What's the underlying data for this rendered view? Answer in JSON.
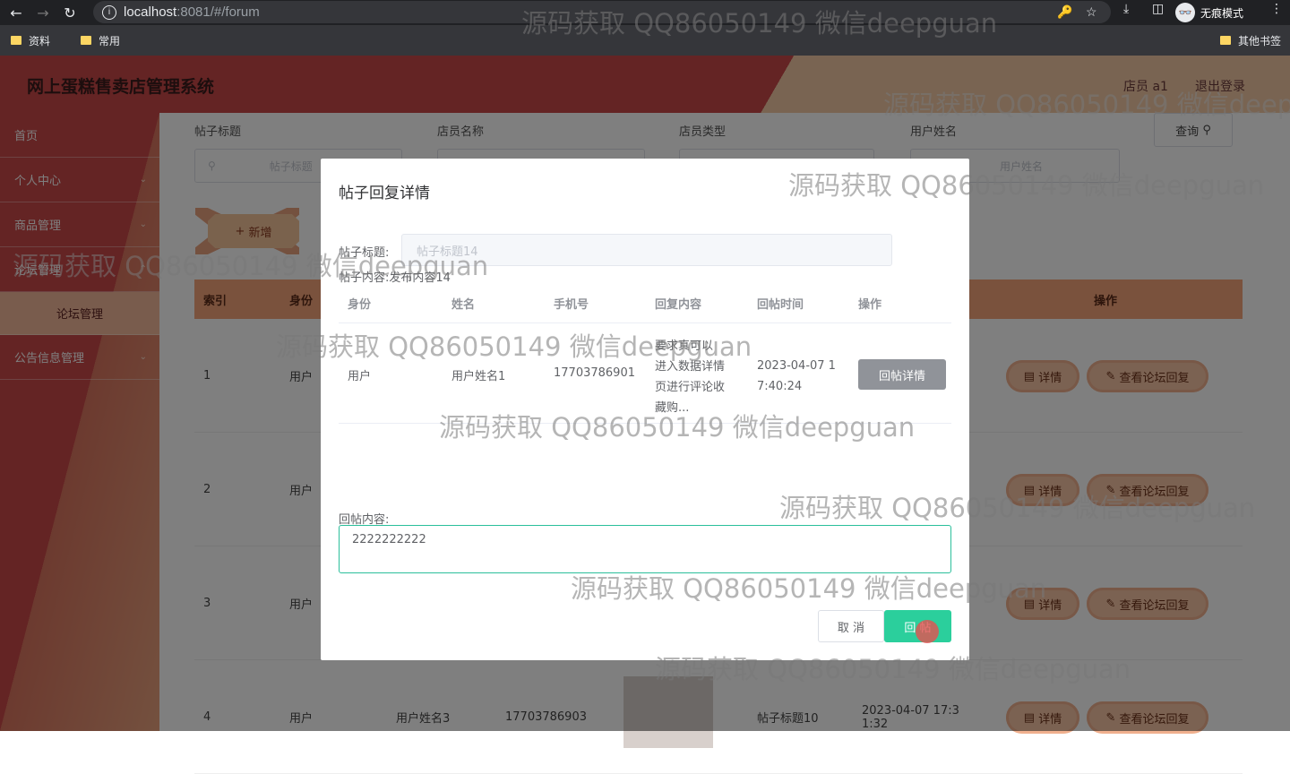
{
  "browser": {
    "url_host": "localhost",
    "url_path": ":8081/#/forum",
    "incognito_label": "无痕模式",
    "bookmarks": [
      "资料",
      "常用"
    ],
    "other_bookmarks": "其他书签"
  },
  "app": {
    "title": "网上蛋糕售卖店管理系统",
    "user": "店员 a1",
    "logout": "退出登录"
  },
  "sidebar": {
    "items": [
      {
        "label": "首页"
      },
      {
        "label": "个人中心"
      },
      {
        "label": "商品管理"
      },
      {
        "label": "论坛管理"
      },
      {
        "label": "论坛管理"
      },
      {
        "label": "公告信息管理"
      }
    ]
  },
  "search": {
    "labels": [
      "帖子标题",
      "店员名称",
      "店员类型",
      "用户姓名"
    ],
    "placeholders": [
      "帖子标题",
      "",
      "",
      "用户姓名"
    ],
    "query_label": "查询",
    "add_label": "新增"
  },
  "table": {
    "headers": [
      "索引",
      "身份",
      "操作"
    ],
    "rows": [
      {
        "index": "1",
        "role": "用户",
        "name": "",
        "phone": "",
        "title": "",
        "time": ""
      },
      {
        "index": "2",
        "role": "用户",
        "name": "",
        "phone": "",
        "title": "",
        "time": ""
      },
      {
        "index": "3",
        "role": "用户",
        "name": "",
        "phone": "",
        "title": "",
        "time": ""
      },
      {
        "index": "4",
        "role": "用户",
        "name": "用户姓名3",
        "phone": "17703786903",
        "title": "帖子标题10",
        "time": "2023-04-07 17:3 1:32"
      }
    ],
    "detail_label": "详情",
    "view_reply_label": "查看论坛回复"
  },
  "dialog": {
    "title": "帖子回复详情",
    "post_title_label": "帖子标题:",
    "post_title_value": "帖子标题14",
    "post_content_label": "帖子内容:",
    "post_content_value": "发布内容14",
    "headers": [
      "身份",
      "姓名",
      "手机号",
      "回复内容",
      "回帖时间",
      "操作"
    ],
    "reply": {
      "role": "用户",
      "name": "用户姓名1",
      "phone": "17703786901",
      "content_lines": [
        "要求真可以",
        "进入数据详情",
        "页进行评论收",
        "藏购..."
      ],
      "time_lines": [
        "2023-04-07 1",
        "7:40:24"
      ],
      "action": "回帖详情"
    },
    "reply_content_label": "回帖内容:",
    "reply_content_value": "2222222222",
    "cancel_label": "取 消",
    "submit_label": "回 帖"
  },
  "watermark": "源码获取 QQ86050149 微信deepguan",
  "colors": {
    "header_red": "#c94848",
    "accent_peach": "#f4a57a",
    "submit_green": "#2bcf9c"
  }
}
